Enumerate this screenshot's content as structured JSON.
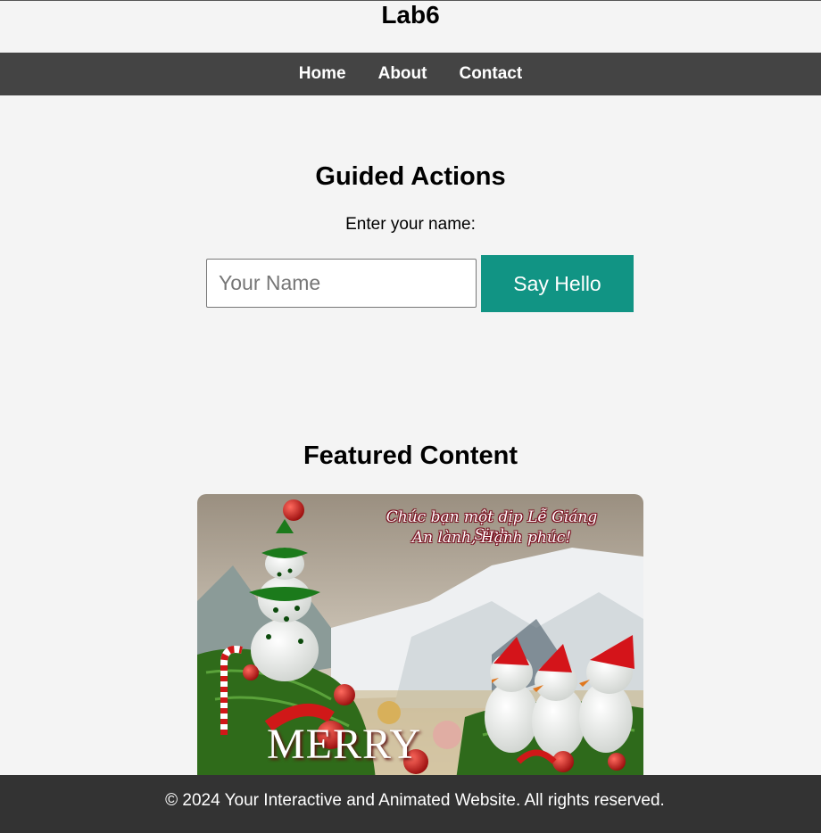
{
  "header": {
    "title": "Lab6"
  },
  "nav": {
    "items": [
      "Home",
      "About",
      "Contact"
    ]
  },
  "guided": {
    "heading": "Guided Actions",
    "prompt": "Enter your name:",
    "input_placeholder": "Your Name",
    "input_value": "",
    "button_label": "Say Hello",
    "button_color": "#119484"
  },
  "featured": {
    "heading": "Featured Content",
    "image": {
      "greeting_line_1": "Chúc bạn một dịp Lễ Giáng Sinh",
      "greeting_line_2": "An lành, Hạnh phúc!",
      "banner_text": "MERRY"
    }
  },
  "footer": {
    "copyright": "© 2024 Your Interactive and Animated Website. All rights reserved."
  },
  "colors": {
    "nav_bg": "#444444",
    "footer_bg": "#333333",
    "page_bg": "#f4f4f4"
  }
}
